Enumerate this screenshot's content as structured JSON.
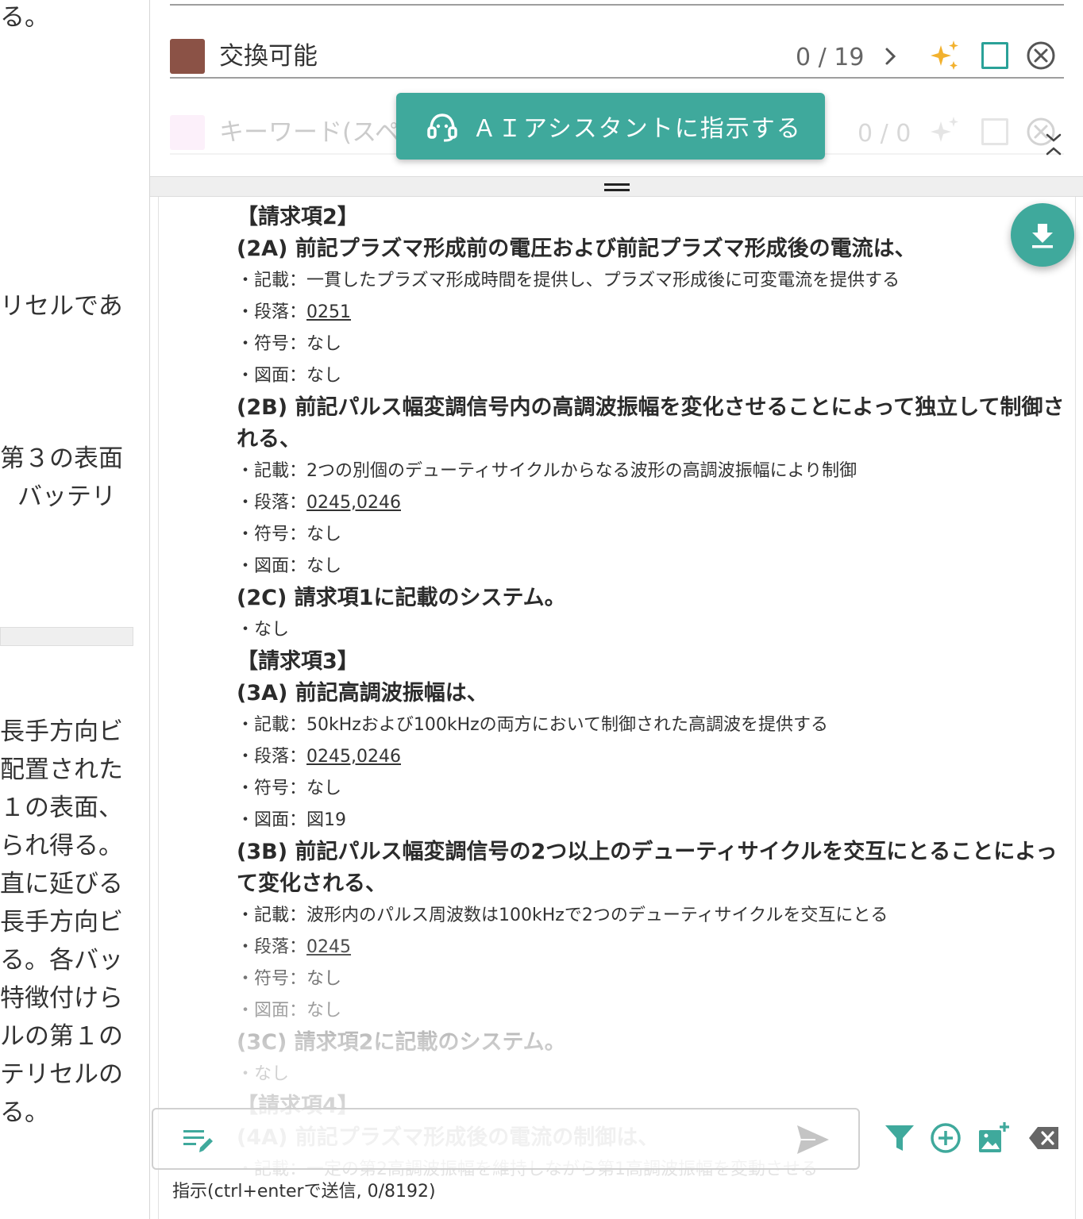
{
  "left_document": {
    "lines": [
      "る。",
      "リセルであ",
      "第３の表面",
      "バッテリ",
      "長手方向ビ",
      "配置された",
      "１の表面、",
      "られ得る。",
      "直に延びる",
      "長手方向ビ",
      "る。各バッ",
      "特徴付けら",
      "ルの第１の",
      "テリセルの",
      "る。"
    ]
  },
  "keywords": [
    {
      "label": "交換可能",
      "count": "0 / 19",
      "color": "#8b5246"
    },
    {
      "label": "キーワード(スペ",
      "count": "0 / 0",
      "color": "#f7c6ec"
    }
  ],
  "ai_button": {
    "label": "ＡＩアシスタントに指示する"
  },
  "content": [
    {
      "kind": "head",
      "text": "【請求項2】"
    },
    {
      "kind": "el",
      "text": "(2A) 前記プラズマ形成前の電圧および前記プラズマ形成後の電流は、"
    },
    {
      "kind": "item",
      "prefix": "・記載：",
      "value": "一貫したプラズマ形成時間を提供し、プラズマ形成後に可変電流を提供する"
    },
    {
      "kind": "item",
      "prefix": "・段落：",
      "value": "0251",
      "link": true
    },
    {
      "kind": "item",
      "prefix": "・符号：",
      "value": "なし"
    },
    {
      "kind": "item",
      "prefix": "・図面：",
      "value": "なし"
    },
    {
      "kind": "el",
      "text": "(2B) 前記パルス幅変調信号内の高調波振幅を変化させることによって独立して制御される、"
    },
    {
      "kind": "item",
      "prefix": "・記載：",
      "value": "2つの別個のデューティサイクルからなる波形の高調波振幅により制御"
    },
    {
      "kind": "item",
      "prefix": "・段落：",
      "value": "0245,0246",
      "link": true
    },
    {
      "kind": "item",
      "prefix": "・符号：",
      "value": "なし"
    },
    {
      "kind": "item",
      "prefix": "・図面：",
      "value": "なし"
    },
    {
      "kind": "el",
      "text": "(2C) 請求項1に記載のシステム。"
    },
    {
      "kind": "item",
      "prefix": "・",
      "value": "なし"
    },
    {
      "kind": "head",
      "text": "【請求項3】"
    },
    {
      "kind": "el",
      "text": "(3A) 前記高調波振幅は、"
    },
    {
      "kind": "item",
      "prefix": "・記載：",
      "value": "50kHzおよび100kHzの両方において制御された高調波を提供する"
    },
    {
      "kind": "item",
      "prefix": "・段落：",
      "value": "0245,0246",
      "link": true
    },
    {
      "kind": "item",
      "prefix": "・符号：",
      "value": "なし"
    },
    {
      "kind": "item",
      "prefix": "・図面：",
      "value": "図19"
    },
    {
      "kind": "el",
      "text": "(3B) 前記パルス幅変調信号の2つ以上のデューティサイクルを交互にとることによって変化される、"
    },
    {
      "kind": "item",
      "prefix": "・記載：",
      "value": "波形内のパルス周波数は100kHzで2つのデューティサイクルを交互にとる"
    },
    {
      "kind": "item",
      "prefix": "・段落：",
      "value": "0245",
      "link": true
    },
    {
      "kind": "item",
      "prefix": "・符号：",
      "value": "なし"
    },
    {
      "kind": "item",
      "prefix": "・図面：",
      "value": "なし"
    },
    {
      "kind": "el",
      "text": "(3C) 請求項2に記載のシステム。"
    },
    {
      "kind": "item",
      "prefix": "・",
      "value": "なし"
    },
    {
      "kind": "head",
      "text": "【請求項4】"
    },
    {
      "kind": "el",
      "text": "(4A) 前記プラズマ形成後の電流の制御は、"
    },
    {
      "kind": "item",
      "prefix": "・記載：",
      "value": "一定の第2高調波振幅を維持しながら第1高調波振幅を変動させる"
    }
  ],
  "instruction": {
    "value": "",
    "placeholder": "",
    "hint": "指示(ctrl+enterで送信, 0/8192)"
  },
  "colors": {
    "accent": "#3fa99c",
    "sparkle": "#f2b12e",
    "danger_icon": "#555555"
  },
  "icons": [
    "sparkle-icon",
    "checkbox-icon",
    "close-circle-icon",
    "chevron-right-icon",
    "assistant-icon",
    "download-icon",
    "edit-list-icon",
    "send-icon",
    "filter-icon",
    "add-circle-icon",
    "add-image-icon",
    "clear-icon"
  ]
}
